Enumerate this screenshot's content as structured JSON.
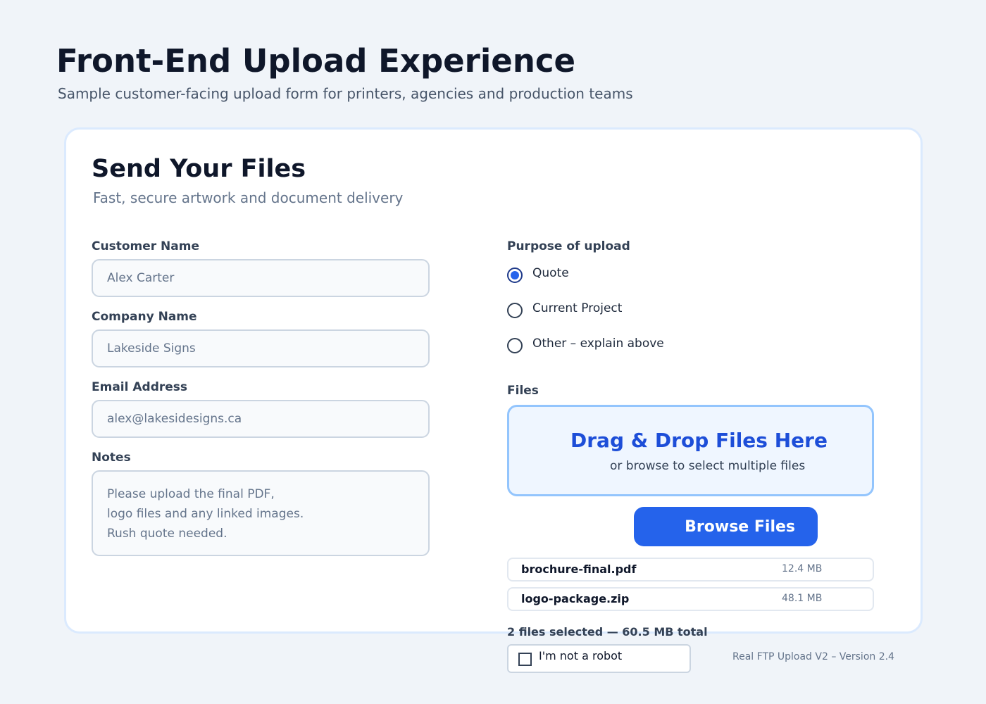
{
  "header": {
    "title": "Front-End Upload Experience",
    "subtitle": "Sample customer-facing upload form for printers, agencies and production teams"
  },
  "form": {
    "title": "Send Your Files",
    "subtitle": "Fast, secure artwork and document delivery",
    "customer_name": {
      "label": "Customer Name",
      "value": "Alex Carter"
    },
    "company_name": {
      "label": "Company Name",
      "value": "Lakeside Signs"
    },
    "email": {
      "label": "Email Address",
      "value": "alex@lakesidesigns.ca"
    },
    "notes": {
      "label": "Notes",
      "lines": [
        "Please upload the final PDF,",
        "logo files and any linked images.",
        "Rush quote needed."
      ]
    },
    "purpose": {
      "label": "Purpose of upload",
      "options": [
        {
          "label": "Quote",
          "checked": true
        },
        {
          "label": "Current Project",
          "checked": false
        },
        {
          "label": "Other – explain above",
          "checked": false
        }
      ]
    },
    "files": {
      "label": "Files",
      "dropzone_title": "Drag & Drop Files Here",
      "dropzone_subtitle": "or browse to select multiple files",
      "browse_label": "Browse Files",
      "items": [
        {
          "name": "brochure-final.pdf",
          "size": "12.4 MB"
        },
        {
          "name": "logo-package.zip",
          "size": "48.1 MB"
        }
      ],
      "summary": "2 files selected — 60.5 MB total"
    },
    "captcha": {
      "label": "I'm not a robot",
      "checked": false
    }
  },
  "footer": {
    "version": "Real FTP Upload V2 – Version 2.4"
  },
  "colors": {
    "accent": "#2563eb",
    "dropzone_title": "#1d4ed8",
    "background": "#f0f4f9"
  }
}
